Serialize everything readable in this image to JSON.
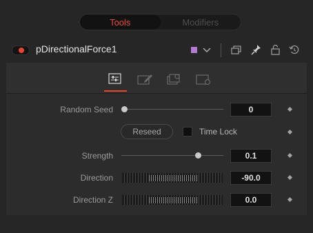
{
  "tabs": [
    {
      "label": "Tools"
    },
    {
      "label": "Modifiers"
    }
  ],
  "header": {
    "tool_name": "pDirectionalForce1",
    "color_swatch": "#b47bd4",
    "accent": "#e8442f",
    "icons": [
      "chevron-down-icon",
      "copy-icon",
      "pin-icon",
      "lock-icon",
      "reset-icon"
    ]
  },
  "subtabs": [
    "controls-icon",
    "edit-icon",
    "settings-icon",
    "render-icon"
  ],
  "controls": {
    "random_seed": {
      "label": "Random Seed",
      "value": "0",
      "slider_position": 0.0
    },
    "reseed": {
      "label": "Reseed"
    },
    "time_lock": {
      "label": "Time Lock",
      "checked": false
    },
    "strength": {
      "label": "Strength",
      "value": "0.1",
      "slider_position": 0.78
    },
    "direction": {
      "label": "Direction",
      "value": "-90.0"
    },
    "direction_z": {
      "label": "Direction Z",
      "value": "0.0"
    }
  }
}
